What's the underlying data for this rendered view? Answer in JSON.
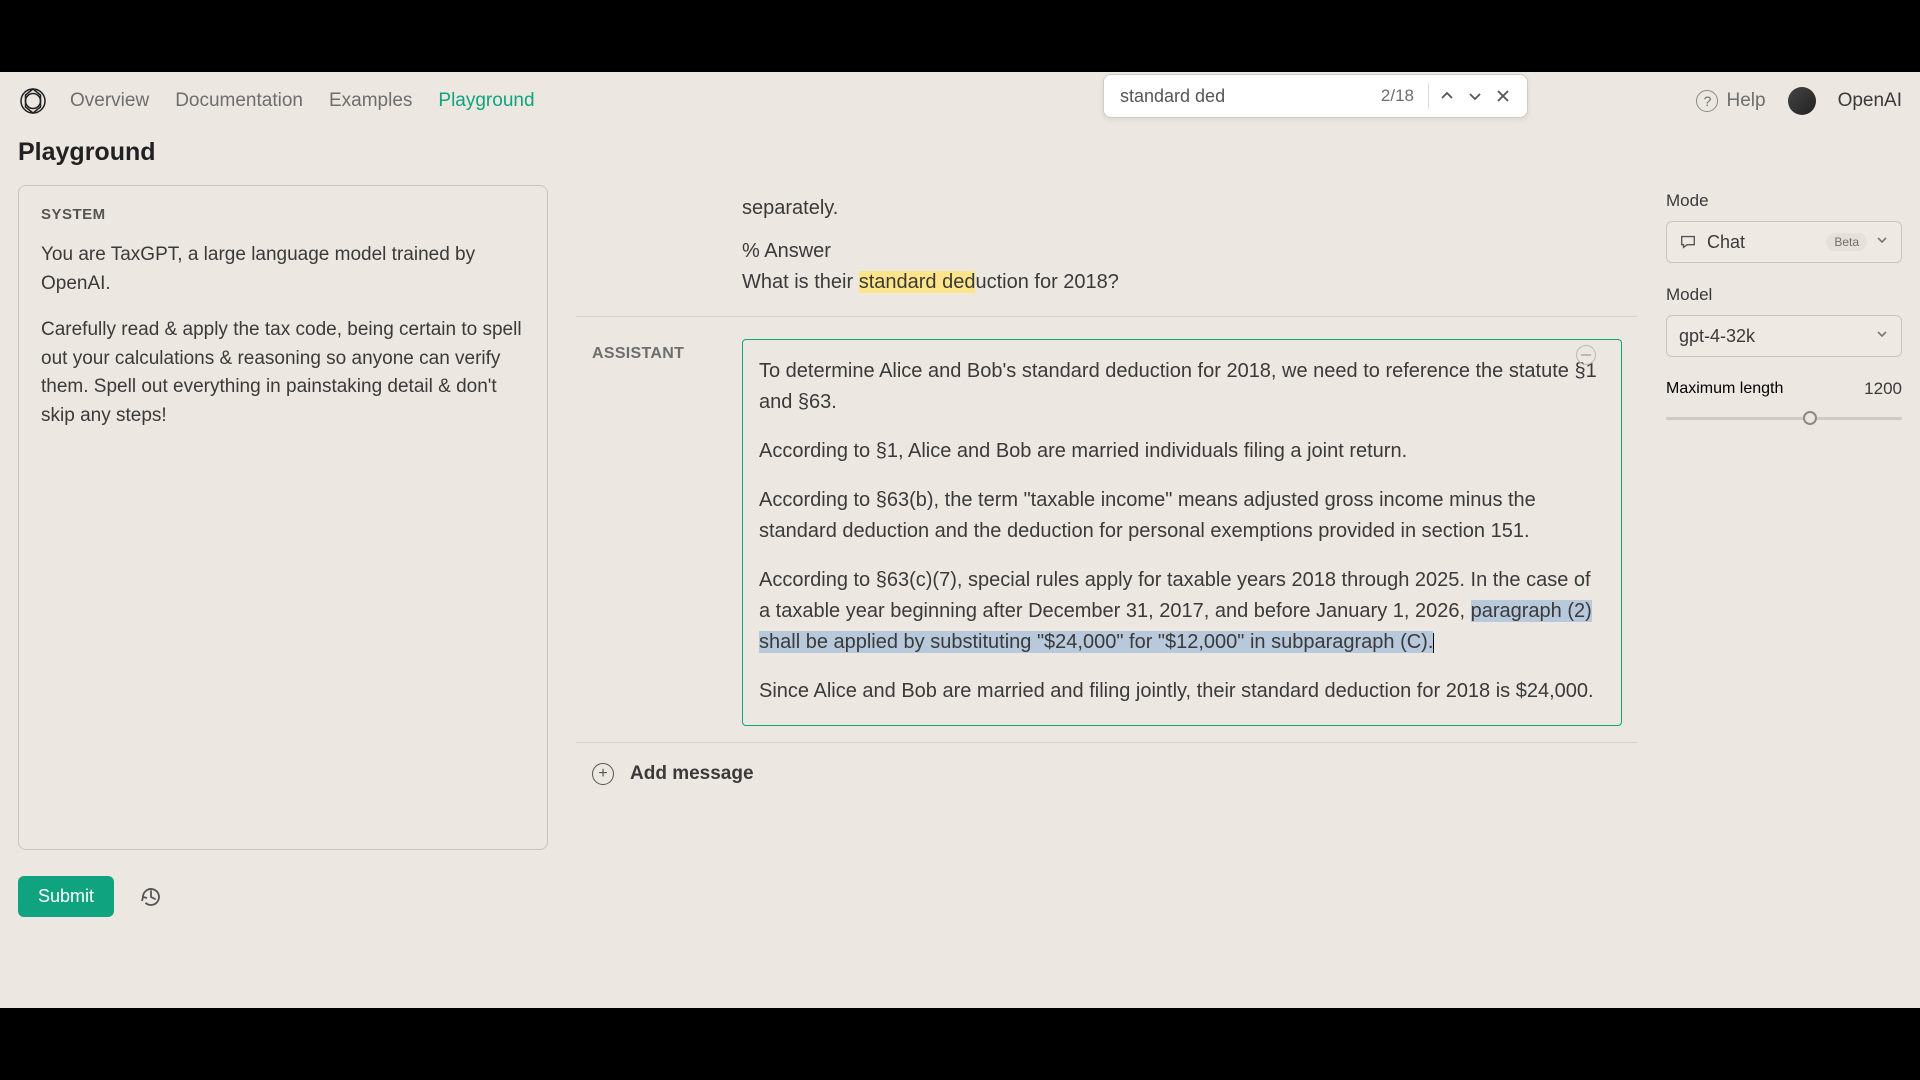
{
  "nav": {
    "items": [
      "Overview",
      "Documentation",
      "Examples",
      "Playground"
    ],
    "active_index": 3
  },
  "header": {
    "help_label": "Help",
    "org_name": "OpenAI"
  },
  "find": {
    "query": "standard ded",
    "count": "2/18"
  },
  "page_title": "Playground",
  "system": {
    "label": "SYSTEM",
    "p1": "You are TaxGPT, a large language model trained by OpenAI.",
    "p2": "Carefully read & apply the tax code, being certain to spell out your calculations & reasoning so anyone can verify them. Spell out everything in painstaking detail & don't skip any steps!"
  },
  "submit_label": "Submit",
  "user_msg": {
    "line0": "separately.",
    "answer_heading": "% Answer",
    "q_before": "What is their ",
    "q_highlight": "standard ded",
    "q_after": "uction for 2018?"
  },
  "assistant": {
    "role_label": "ASSISTANT",
    "p1": "To determine Alice and Bob's standard deduction for 2018, we need to reference the statute §1 and §63.",
    "p2": "According to §1, Alice and Bob are married individuals filing a joint return.",
    "p3": "According to §63(b), the term \"taxable income\" means adjusted gross income minus the standard deduction and the deduction for personal exemptions provided in section 151.",
    "p4_before": "According to §63(c)(7), special rules apply for taxable years 2018 through 2025. In the case of a taxable year beginning after December 31, 2017, and before January 1, 2026, ",
    "p4_sel": "paragraph (2) shall be applied by substituting \"$24,000\" for \"$12,000\" in subparagraph (C).",
    "p5": "Since Alice and Bob are married and filing jointly, their standard deduction for 2018 is $24,000."
  },
  "add_message_label": "Add message",
  "settings": {
    "mode_label": "Mode",
    "mode_value": "Chat",
    "mode_badge": "Beta",
    "model_label": "Model",
    "model_value": "gpt-4-32k",
    "maxlen_label": "Maximum length",
    "maxlen_value": "1200",
    "maxlen_percent": 58
  }
}
